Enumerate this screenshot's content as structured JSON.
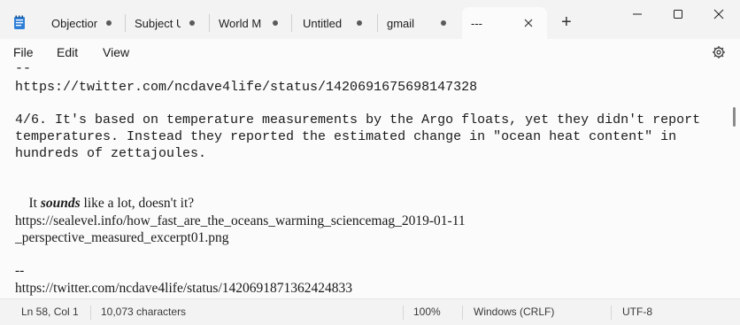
{
  "tabs": [
    {
      "label": "Objection",
      "state": "modified"
    },
    {
      "label": "Subject U",
      "state": "modified"
    },
    {
      "label": "World M",
      "state": "modified"
    },
    {
      "label": "Untitled",
      "state": "modified"
    },
    {
      "label": "gmail",
      "state": "modified"
    },
    {
      "label": "---",
      "state": "active"
    }
  ],
  "new_tab_glyph": "+",
  "menu": {
    "file": "File",
    "edit": "Edit",
    "view": "View"
  },
  "document": {
    "line1": "--",
    "line2": "https://twitter.com/ncdave4life/status/1420691675698147328",
    "line3": "4/6. It's based on temperature measurements by the Argo floats, yet they didn't report",
    "line4": "temperatures. Instead they reported the estimated change in \"ocean heat content\" in",
    "line5": "hundreds of zettajoules.",
    "line6_pre": "It ",
    "line6_emph": "sounds",
    "line6_post": " like a lot, doesn't it?",
    "line7": "https://sealevel.info/how_fast_are_the_oceans_warming_sciencemag_2019-01-11",
    "line8": "_perspective_measured_excerpt01.png",
    "line9": "--",
    "line10": "https://twitter.com/ncdave4life/status/1420691871362424833"
  },
  "status": {
    "position": "Ln 58, Col 1",
    "characters": "10,073 characters",
    "zoom": "100%",
    "line_ending": "Windows (CRLF)",
    "encoding": "UTF-8"
  },
  "icons": {
    "app": "notepad-icon",
    "settings": "gear-icon",
    "minimize": "minimize-icon",
    "maximize": "maximize-icon",
    "close": "close-icon"
  }
}
